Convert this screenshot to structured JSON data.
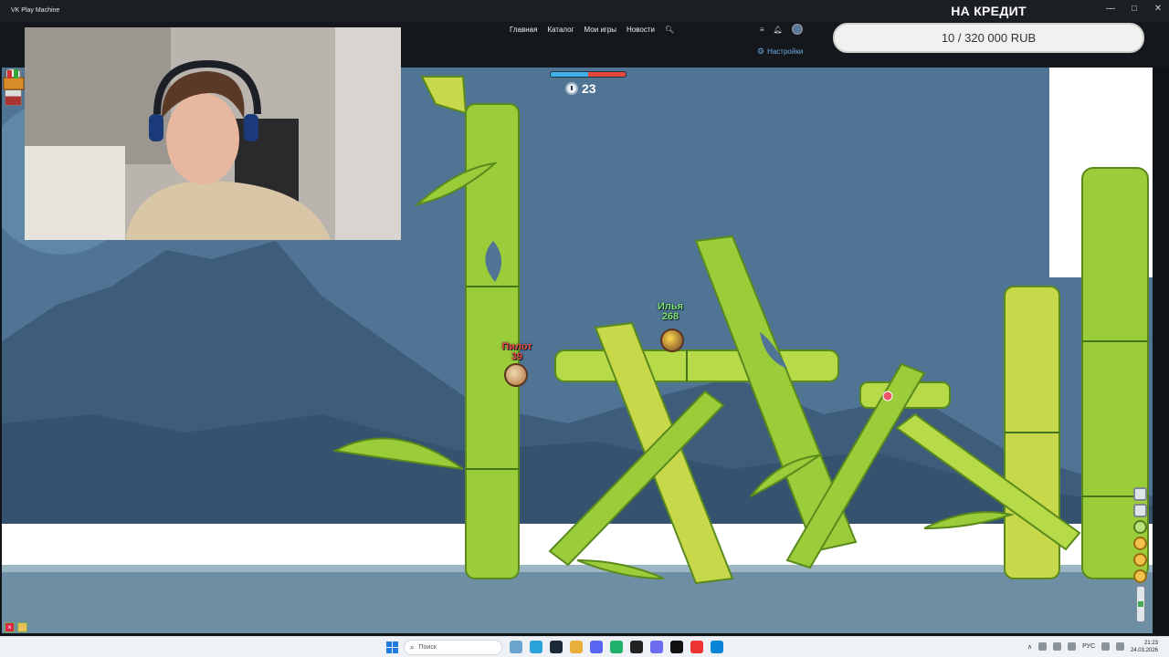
{
  "window": {
    "title": "VK Play Machine",
    "controls": [
      "—",
      "□",
      "✕"
    ]
  },
  "nav": {
    "items": [
      "Главная",
      "Каталог",
      "Мои игры",
      "Новости"
    ],
    "settings": "Настройки"
  },
  "overlay": {
    "credit_title": "НА КРЕДИТ",
    "credit_progress": "10 / 320 000 RUB",
    "credit_current": 10,
    "credit_goal": 320000
  },
  "game": {
    "turn_time": "23",
    "worms": [
      {
        "name": "Пилот",
        "hp": "39",
        "team": "enemy"
      },
      {
        "name": "Илья",
        "hp": "268",
        "team": "ally"
      }
    ],
    "health_bar_colors": {
      "team_a": "#3fb1ea",
      "team_b": "#e5473a"
    }
  },
  "taskbar": {
    "search_placeholder": "Поиск",
    "lang": "РУС",
    "time": "21:23",
    "date": "24.03.2026"
  }
}
